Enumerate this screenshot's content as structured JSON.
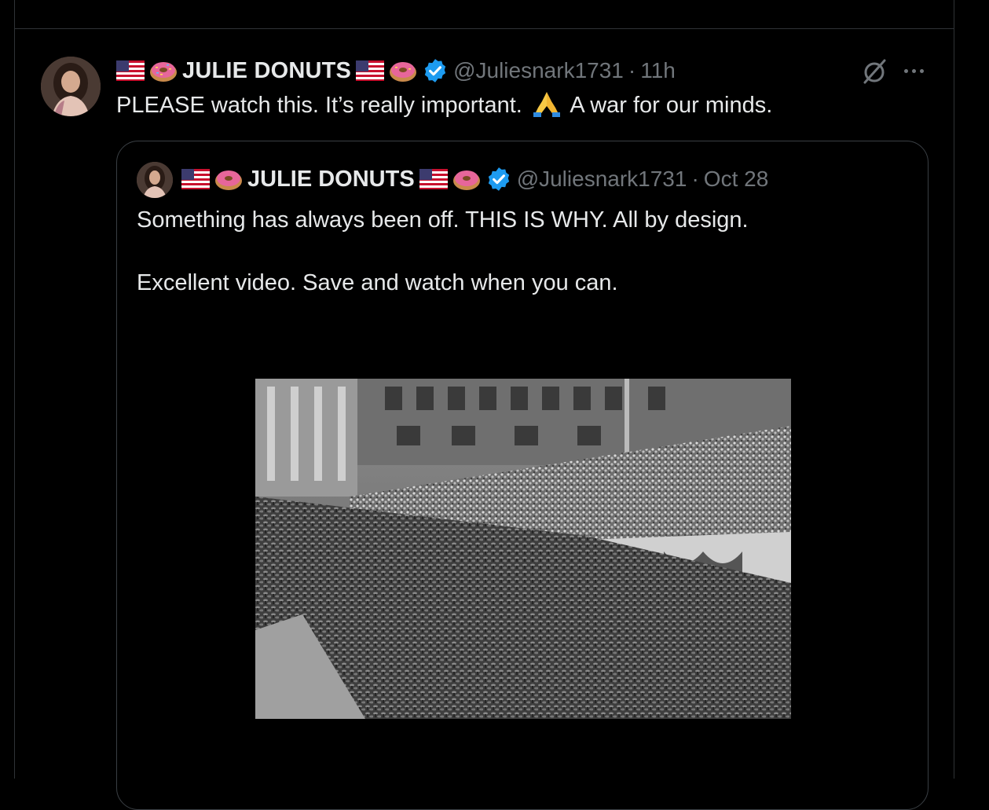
{
  "tweet": {
    "display_name": "JULIE DONUTS",
    "handle": "@Juliesnark1731",
    "separator": "·",
    "time": "11h",
    "text_before_emoji": "PLEASE watch this. It’s really important.",
    "text_after_emoji": "A war for our minds.",
    "emoji_icons": [
      "us-flag-icon",
      "donut-icon",
      "verified-badge-icon",
      "praying-hands-icon"
    ]
  },
  "quote": {
    "display_name": "JULIE DONUTS",
    "handle": "@Juliesnark1731",
    "separator": "·",
    "time": "Oct 28",
    "line1": "Something has always been off. THIS IS WHY. All by design.",
    "line2": "Excellent video. Save and watch when you can."
  },
  "colors": {
    "background": "#000000",
    "text": "#e7e9ea",
    "secondary_text": "#71767b",
    "border": "#2f3336",
    "verified_blue": "#1d9bf0"
  }
}
